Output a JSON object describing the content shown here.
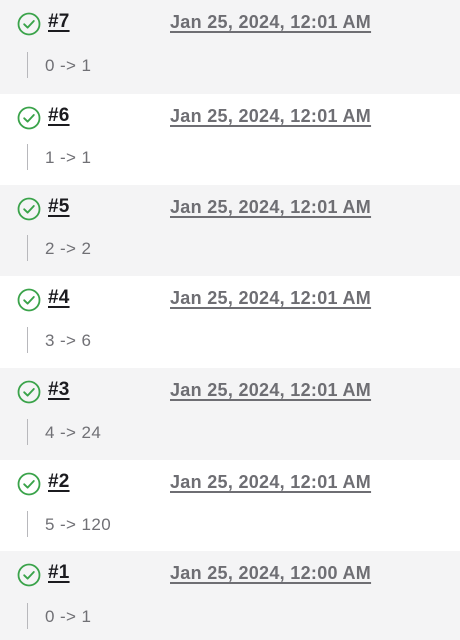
{
  "colors": {
    "success": "#3aa34a",
    "row_alt_bg": "#f4f4f5",
    "row_plain_bg": "#ffffff"
  },
  "builds": [
    {
      "number": "#7",
      "timestamp": "Jan 25, 2024, 12:01 AM",
      "description": "0 -> 1",
      "status": "success",
      "status_icon": "check-circle-icon"
    },
    {
      "number": "#6",
      "timestamp": "Jan 25, 2024, 12:01 AM",
      "description": "1 -> 1",
      "status": "success",
      "status_icon": "check-circle-icon"
    },
    {
      "number": "#5",
      "timestamp": "Jan 25, 2024, 12:01 AM",
      "description": "2 -> 2",
      "status": "success",
      "status_icon": "check-circle-icon"
    },
    {
      "number": "#4",
      "timestamp": "Jan 25, 2024, 12:01 AM",
      "description": "3 -> 6",
      "status": "success",
      "status_icon": "check-circle-icon"
    },
    {
      "number": "#3",
      "timestamp": "Jan 25, 2024, 12:01 AM",
      "description": "4 -> 24",
      "status": "success",
      "status_icon": "check-circle-icon"
    },
    {
      "number": "#2",
      "timestamp": "Jan 25, 2024, 12:01 AM",
      "description": "5 -> 120",
      "status": "success",
      "status_icon": "check-circle-icon"
    },
    {
      "number": "#1",
      "timestamp": "Jan 25, 2024, 12:00 AM",
      "description": "0 -> 1",
      "status": "success",
      "status_icon": "check-circle-icon"
    }
  ]
}
